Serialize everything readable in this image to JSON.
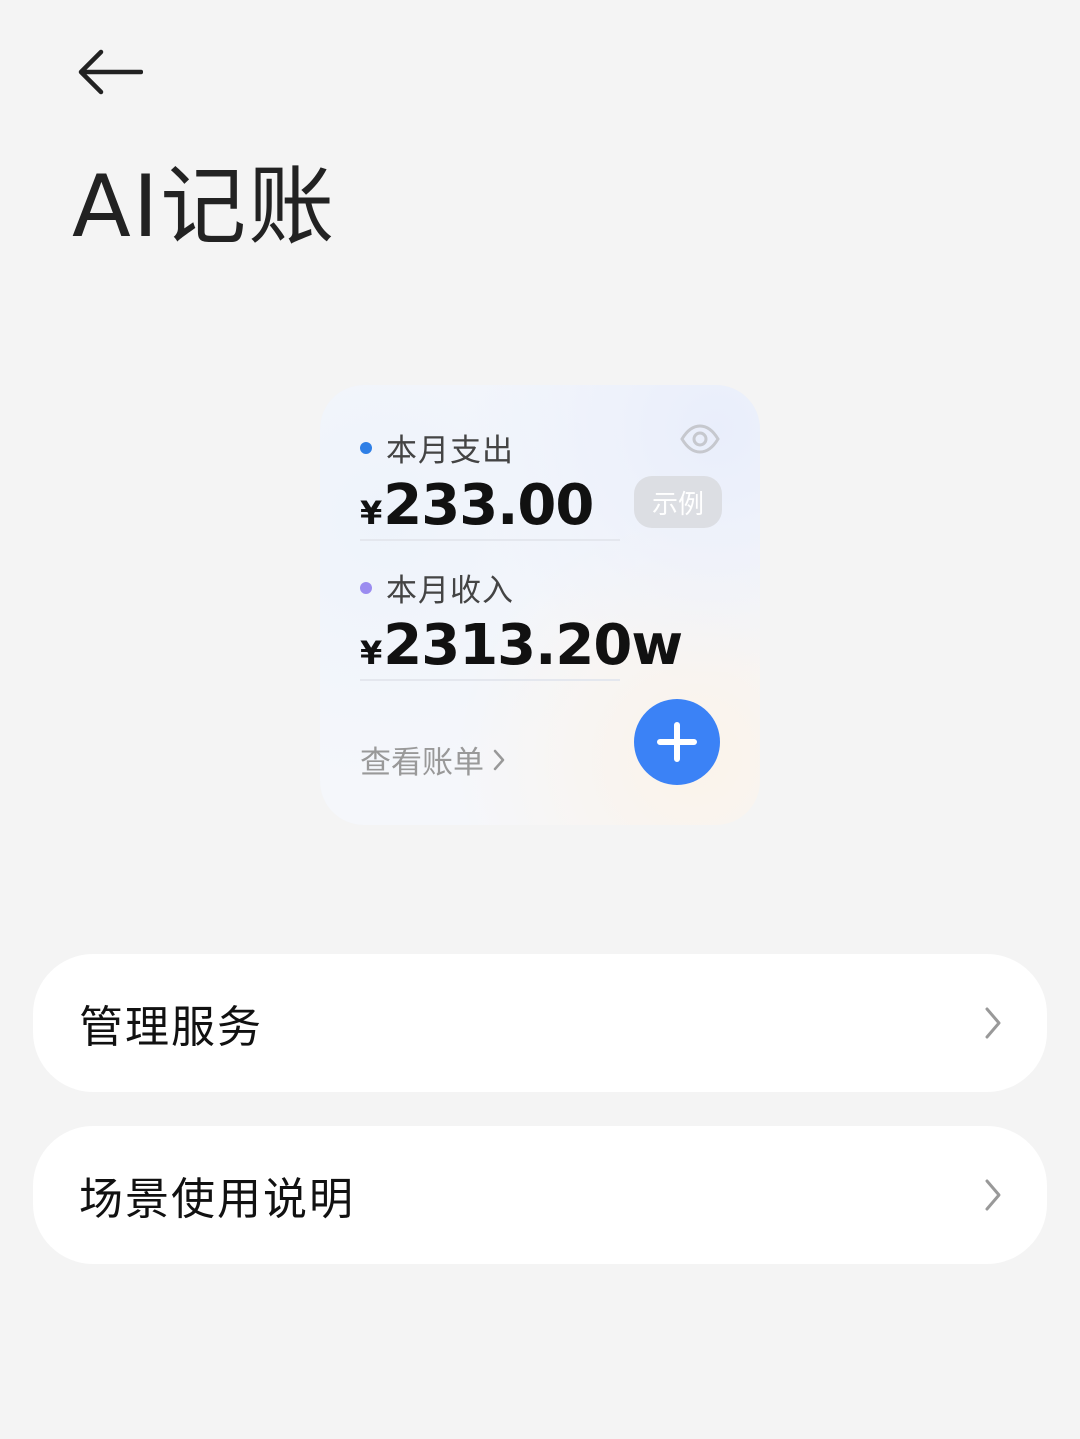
{
  "header": {
    "back_icon": "arrow-left-icon",
    "title": "AI记账"
  },
  "widget": {
    "expense": {
      "label": "本月支出",
      "currency": "¥",
      "amount": "233.00",
      "dot_color": "#2f7fe6"
    },
    "income": {
      "label": "本月收入",
      "currency": "¥",
      "amount": "2313.20w",
      "dot_color": "#9b8cf0"
    },
    "visibility_icon": "eye-icon",
    "sample_badge": "示例",
    "view_bills_label": "查看账单",
    "add_icon": "plus-icon",
    "accent_color": "#3b82f6"
  },
  "menu": {
    "items": [
      {
        "label": "管理服务",
        "icon": "chevron-right-icon"
      },
      {
        "label": "场景使用说明",
        "icon": "chevron-right-icon"
      }
    ]
  }
}
